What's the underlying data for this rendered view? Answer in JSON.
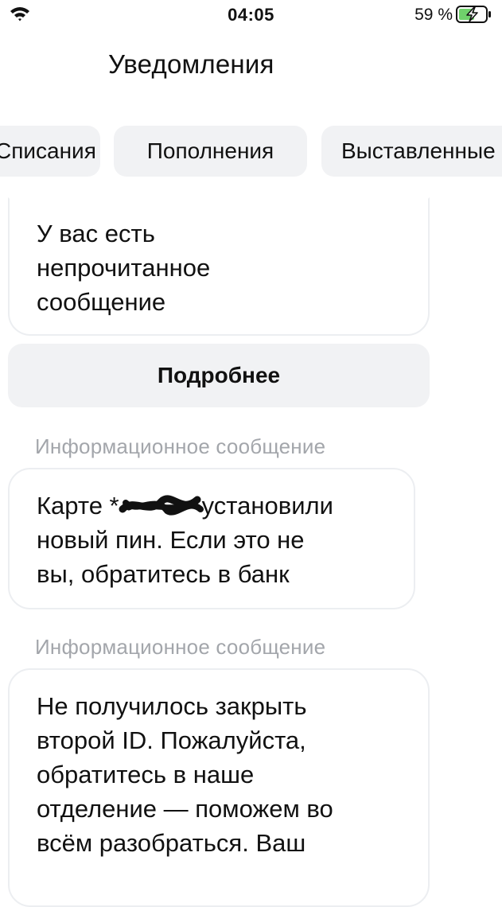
{
  "status_bar": {
    "time": "04:05",
    "battery_percent": "59 %"
  },
  "header": {
    "title": "Уведомления"
  },
  "tabs": [
    {
      "label": "Списания"
    },
    {
      "label": "Пополнения"
    },
    {
      "label": "Выставленные"
    }
  ],
  "messages": [
    {
      "text": "У вас есть\nнепрочитанное\nсообщение",
      "button_label": "Подробнее"
    },
    {
      "type_label": "Информационное сообщение",
      "text_start": "Карте *",
      "text_rest": "установили\nновый пин. Если это не\nвы, обратитесь в банк"
    },
    {
      "type_label": "Информационное сообщение",
      "text": "Не получилось закрыть\nвторой ID. Пожалуйста,\nобратитесь в наше\nотделение — поможем во\nвсём разобраться. Ваш"
    }
  ],
  "icons": {
    "wifi": "wifi-icon",
    "battery": "battery-charging-icon",
    "redaction": "redaction-scribble-icon"
  },
  "colors": {
    "chip_bg": "#f1f2f4",
    "label_gray": "#a3a6ab",
    "bubble_border": "#eceef1"
  }
}
